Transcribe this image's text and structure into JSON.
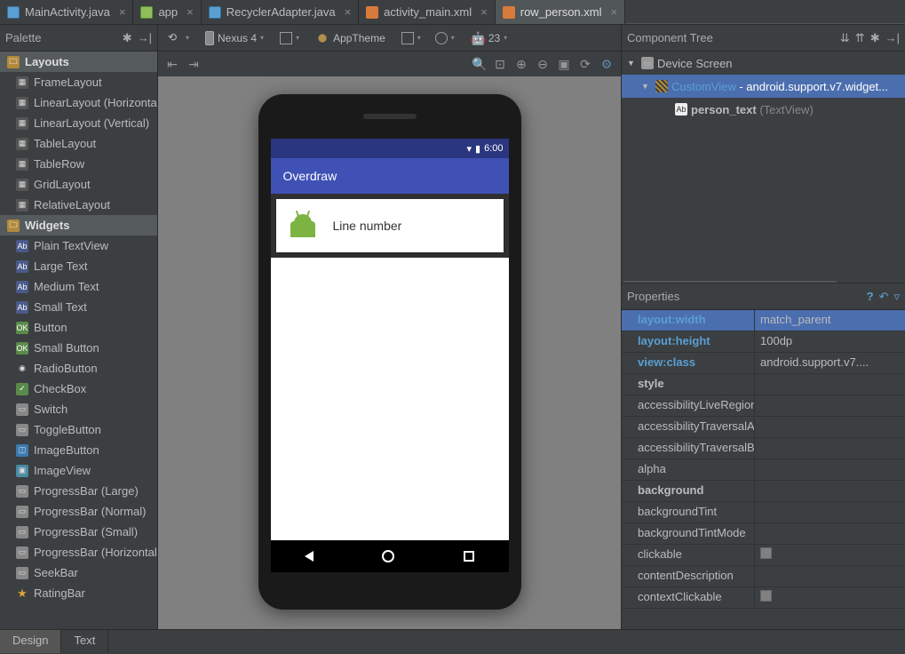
{
  "tabs": [
    {
      "label": "MainActivity.java",
      "icon": "java"
    },
    {
      "label": "app",
      "icon": "app"
    },
    {
      "label": "RecyclerAdapter.java",
      "icon": "java"
    },
    {
      "label": "activity_main.xml",
      "icon": "xml"
    },
    {
      "label": "row_person.xml",
      "icon": "xml",
      "active": true
    }
  ],
  "palette": {
    "title": "Palette",
    "groups": [
      {
        "title": "Layouts",
        "items": [
          {
            "label": "FrameLayout",
            "ico": ""
          },
          {
            "label": "LinearLayout (Horizontal)",
            "ico": ""
          },
          {
            "label": "LinearLayout (Vertical)",
            "ico": ""
          },
          {
            "label": "TableLayout",
            "ico": ""
          },
          {
            "label": "TableRow",
            "ico": ""
          },
          {
            "label": "GridLayout",
            "ico": ""
          },
          {
            "label": "RelativeLayout",
            "ico": ""
          }
        ]
      },
      {
        "title": "Widgets",
        "items": [
          {
            "label": "Plain TextView",
            "ico": "ab"
          },
          {
            "label": "Large Text",
            "ico": "ab"
          },
          {
            "label": "Medium Text",
            "ico": "ab"
          },
          {
            "label": "Small Text",
            "ico": "ab"
          },
          {
            "label": "Button",
            "ico": "ok"
          },
          {
            "label": "Small Button",
            "ico": "ok"
          },
          {
            "label": "RadioButton",
            "ico": "radio"
          },
          {
            "label": "CheckBox",
            "ico": "chk"
          },
          {
            "label": "Switch",
            "ico": "bar"
          },
          {
            "label": "ToggleButton",
            "ico": "bar"
          },
          {
            "label": "ImageButton",
            "ico": "cam"
          },
          {
            "label": "ImageView",
            "ico": "img"
          },
          {
            "label": "ProgressBar (Large)",
            "ico": "bar"
          },
          {
            "label": "ProgressBar (Normal)",
            "ico": "bar"
          },
          {
            "label": "ProgressBar (Small)",
            "ico": "bar"
          },
          {
            "label": "ProgressBar (Horizontal)",
            "ico": "bar"
          },
          {
            "label": "SeekBar",
            "ico": "bar"
          },
          {
            "label": "RatingBar",
            "ico": "star"
          }
        ]
      }
    ]
  },
  "toolbar": {
    "device": "Nexus 4",
    "theme": "AppTheme",
    "api": "23"
  },
  "preview": {
    "status_time": "6:00",
    "app_title": "Overdraw",
    "card_text": "Line number"
  },
  "ctree": {
    "title": "Component Tree",
    "root": "Device Screen",
    "custom": "CustomView",
    "custom_type": "android.support.v7.widget...",
    "leaf": "person_text",
    "leaf_type": "(TextView)"
  },
  "properties": {
    "title": "Properties",
    "rows": [
      {
        "name": "layout:width",
        "val": "match_parent",
        "hl": true,
        "sel": true
      },
      {
        "name": "layout:height",
        "val": "100dp",
        "hl": true
      },
      {
        "name": "view:class",
        "val": "android.support.v7....",
        "hl": true
      },
      {
        "name": "style",
        "val": "",
        "bold": true
      },
      {
        "name": "accessibilityLiveRegion",
        "val": ""
      },
      {
        "name": "accessibilityTraversalAfter",
        "val": ""
      },
      {
        "name": "accessibilityTraversalBefore",
        "val": ""
      },
      {
        "name": "alpha",
        "val": ""
      },
      {
        "name": "background",
        "val": "",
        "bold": true
      },
      {
        "name": "backgroundTint",
        "val": ""
      },
      {
        "name": "backgroundTintMode",
        "val": ""
      },
      {
        "name": "clickable",
        "val": "",
        "check": true
      },
      {
        "name": "contentDescription",
        "val": ""
      },
      {
        "name": "contextClickable",
        "val": "",
        "check": true
      }
    ]
  },
  "bottom": {
    "design": "Design",
    "text": "Text"
  }
}
